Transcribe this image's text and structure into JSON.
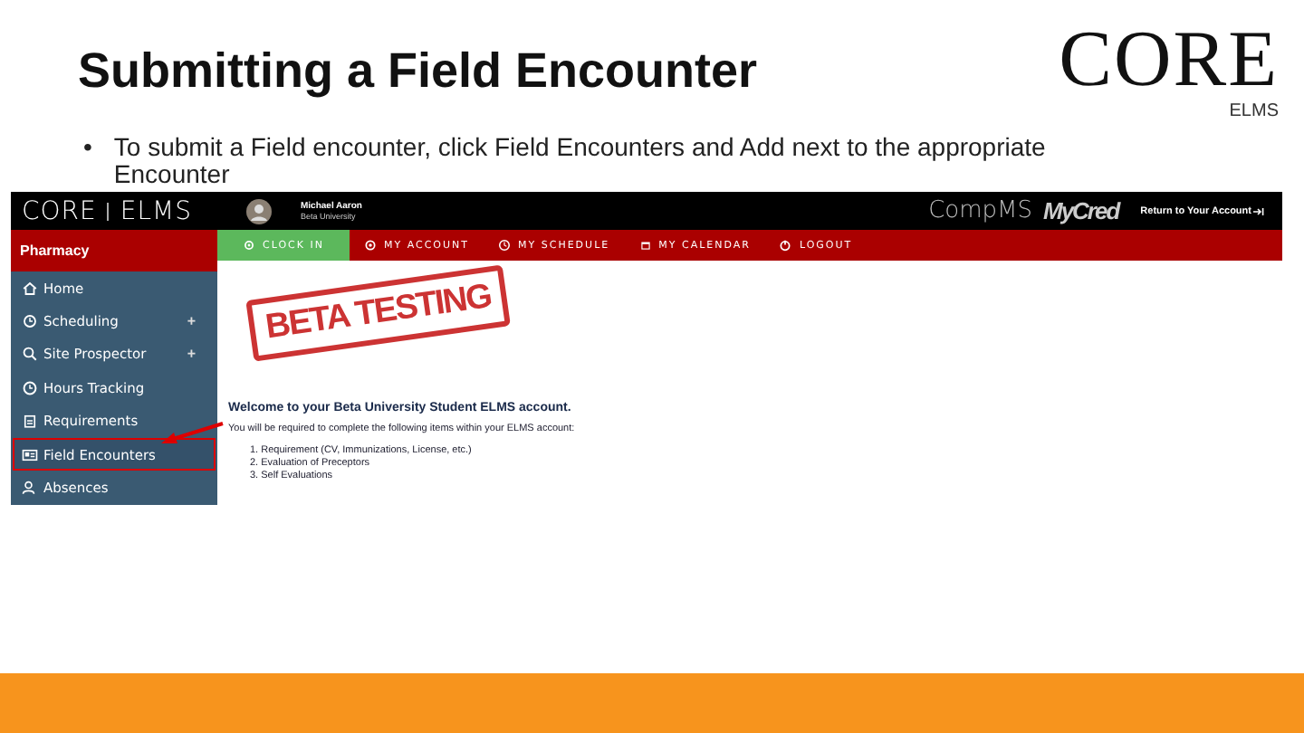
{
  "slide": {
    "title": "Submitting a Field Encounter",
    "logo": {
      "name": "CORE",
      "sub": "ELMS"
    },
    "bullets": [
      {
        "marker": "•",
        "text": "To submit a Field encounter, click Field Encounters and Add next to the appropriate Encounter"
      }
    ]
  },
  "app": {
    "logo": "CORE",
    "logo_sub": "ELMS",
    "user": {
      "name": "Michael Aaron",
      "school": "Beta University"
    },
    "brands": [
      "CompMS",
      "MyCred"
    ],
    "return_link": "Return to Your Account",
    "program": "Pharmacy",
    "nav": [
      {
        "label": "CLOCK IN",
        "selected": true
      },
      {
        "label": "MY ACCOUNT",
        "selected": false
      },
      {
        "label": "MY SCHEDULE",
        "selected": false
      },
      {
        "label": "MY CALENDAR",
        "selected": false
      },
      {
        "label": "LOGOUT",
        "selected": false
      }
    ],
    "sidebar": [
      {
        "label": "Home",
        "selected": false
      },
      {
        "label": "Scheduling",
        "toggle": "+",
        "selected": false
      },
      {
        "label": "Site Prospector",
        "toggle": "+",
        "selected": false
      },
      {
        "label": "Hours Tracking",
        "selected": false
      },
      {
        "label": "Requirements",
        "selected": false
      },
      {
        "label": "Field Encounters",
        "selected": true
      },
      {
        "label": "Absences",
        "selected": false
      }
    ],
    "stamp": "BETA TESTING",
    "welcome": "Welcome to your Beta University Student ELMS account.",
    "intro": "You will be required to complete the following items within your ELMS account:",
    "items": [
      "1. Requirement (CV, Immunizations, License, etc.)",
      "2. Evaluation of Preceptors",
      "3. Self Evaluations"
    ]
  }
}
